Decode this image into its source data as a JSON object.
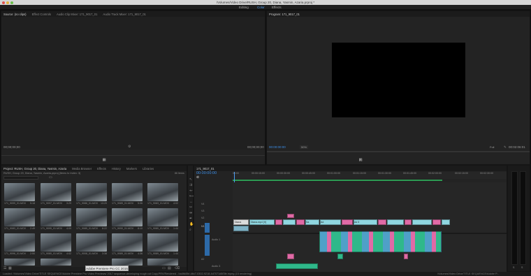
{
  "window": {
    "title": "/Volumes/Video Drive/RUSH, Group 20, Diana, Yasmin, Azaria.prproj *"
  },
  "workspaces": [
    "Editing",
    "Color",
    "Effects"
  ],
  "source_panel": {
    "tabs": [
      "Source: (no clips)",
      "Effect Controls",
      "Audio Clip Mixer: 171_9017_01",
      "Audio Track Mixer: 171_9017_01"
    ],
    "timecode_left": "00;00;00;00",
    "timecode_right": "00;00;00;00"
  },
  "program_panel": {
    "tab": "Program: 171_9017_01",
    "timecode_left": "00:00:00:00",
    "fit": "50%",
    "full": "Full",
    "timecode_right": "00:02:06:01"
  },
  "project_panel": {
    "tabs": [
      "Project: RUSH, Group 20, Diana, Yasmin, Azaria",
      "Media Browser",
      "Effects",
      "History",
      "Markers",
      "Libraries"
    ],
    "path": "RUSH, Group 20, Diana, Yasmin, Azaria.prproj (Items to Index: 3)",
    "item_count": "86 Items",
    "clips": [
      {
        "name": "171_9099_01.MOV",
        "dur": "5:18"
      },
      {
        "name": "171_9097_01.MOV",
        "dur": "3:29"
      },
      {
        "name": "171_9086_01.MOV",
        "dur": "13:20"
      },
      {
        "name": "171_9089_01.MOV",
        "dur": "5:06"
      },
      {
        "name": "171_9083_01.MOV",
        "dur": "4:02"
      },
      {
        "name": "171_9083_01.MOV",
        "dur": "2:49"
      },
      {
        "name": "171_9095_01.MOV",
        "dur": "4:09"
      },
      {
        "name": "171_9085_01.MOV",
        "dur": "8:22"
      },
      {
        "name": "171_9090_01.MOV",
        "dur": "8:10"
      },
      {
        "name": "171_9080_01.MOV",
        "dur": "1:44"
      },
      {
        "name": "171_9096_01.MOV",
        "dur": "2:50"
      },
      {
        "name": "171_9080_01.MOV",
        "dur": "4:02"
      },
      {
        "name": "171_9008_01.MOV",
        "dur": "3:38"
      },
      {
        "name": "171_9089_01.MOV",
        "dur": "4:36"
      },
      {
        "name": "171_9089_01.MOV",
        "dur": "1:44"
      }
    ]
  },
  "timeline": {
    "tab": "171_9017_01",
    "timecode": "00:00:00:00",
    "ruler": [
      "00:00",
      "00:00:15:00",
      "00:00:30:00",
      "00:00:45:00",
      "00:01:00:00",
      "00:01:15:00",
      "00:01:30:00",
      "00:01:45:00",
      "00:02:00:00",
      "00:02:15:00",
      "00:02:30:00"
    ],
    "tracks": [
      "V4",
      "V3",
      "V2",
      "V1",
      "A1",
      "A2",
      "A3",
      "A4"
    ],
    "track_label_a1": "Audio 1",
    "track_label_a3": "Audio 3",
    "clip_labels": [
      "Diana",
      "Diana.mp4 [V]",
      "Sa",
      "Ad",
      "Ad 3"
    ]
  },
  "tooltip": "Adobe Premiere Pro CC 2015",
  "status": {
    "left": "Loaded: /Volumes/Video Drive/TITLE SEQUENCE/Adobe Premiere Pro Video Previews/ 2017 sequence-developing rough cut Copy.PRV/Rendered - ba4fd49e-dbc7-0302-9218-4d7071d5f3fe.mpeg (15 rendering)",
    "right": "/Volumes/Video Drive/TITLE SEQUENCE/Adobe P..."
  },
  "meter": {
    "label_left": "S",
    "label_right": "S"
  }
}
